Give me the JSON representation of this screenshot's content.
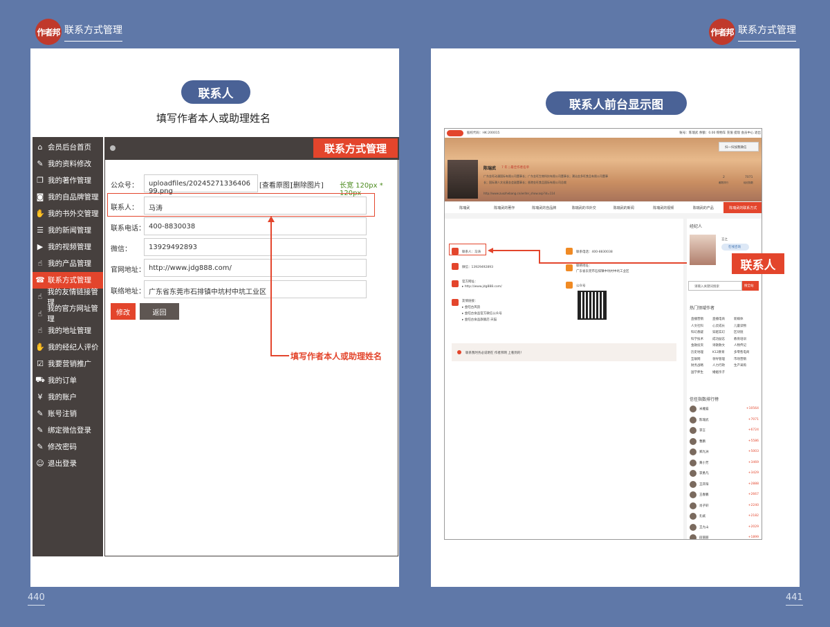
{
  "header": {
    "logo_text": "作者邦",
    "title": "联系方式管理"
  },
  "pages": {
    "left_no": "440",
    "right_no": "441"
  },
  "left": {
    "pill": "联系人",
    "subtitle": "填写作者本人或助理姓名",
    "sidebar": [
      {
        "label": "会员后台首页",
        "icon": "home-icon"
      },
      {
        "label": "我的资料修改",
        "icon": "edit-icon"
      },
      {
        "label": "我的著作管理",
        "icon": "book-icon"
      },
      {
        "label": "我的自品牌管理",
        "icon": "camera-icon"
      },
      {
        "label": "我的书外交管理",
        "icon": "handshake-icon"
      },
      {
        "label": "我的新闻管理",
        "icon": "news-icon"
      },
      {
        "label": "我的视频管理",
        "icon": "play-icon"
      },
      {
        "label": "我的产品管理",
        "icon": "hand-icon"
      },
      {
        "label": "联系方式管理",
        "icon": "phone-icon"
      },
      {
        "label": "我的友情链接管理",
        "icon": "hand-icon"
      },
      {
        "label": "我的官方网址管理",
        "icon": "hand-icon"
      },
      {
        "label": "我的地址管理",
        "icon": "hand-icon"
      },
      {
        "label": "我的经纪人评价",
        "icon": "handshake-icon"
      },
      {
        "label": "我要营销推广",
        "icon": "checkbox-icon"
      },
      {
        "label": "我的订单",
        "icon": "cart-icon"
      },
      {
        "label": "我的账户",
        "icon": "yen-icon"
      },
      {
        "label": "账号注销",
        "icon": "doc-icon"
      },
      {
        "label": "绑定微信登录",
        "icon": "doc-icon"
      },
      {
        "label": "修改密码",
        "icon": "doc-icon"
      },
      {
        "label": "退出登录",
        "icon": "user-icon"
      }
    ],
    "active_index": 8,
    "panel_title": "联系方式管理",
    "form": {
      "gzh_label": "公众号：",
      "gzh_value": "uploadfiles/20245271336406​99.png",
      "view_orig": "[查看原图]",
      "delete_img": "[删除图片]",
      "size_hint": "长宽 120px * 120px",
      "contact_label": "联系人：",
      "contact_value": "马涛",
      "phone_label": "联系电话：",
      "phone_value": "400-8830038",
      "wechat_label": "微信：",
      "wechat_value": "13929492893",
      "site_label": "官网地址：",
      "site_value": "http://www.jdg888.com/",
      "addr_label": "联络地址：",
      "addr_value": "广东省东莞市石排镇中坑村中坑工业区",
      "modify_btn": "修改",
      "back_btn": "返回"
    },
    "annotation": "填写作者本人或助理姓名"
  },
  "right": {
    "pill": "联系人前台显示图",
    "callout": "联系人",
    "site": {
      "topnav_left": "股权代码：HK:200015",
      "topnav_right": "账号：陈瑞武  余额：0.00  购物车  充值  提现  会员中心  退出",
      "scan_btn": "扫一扫加我微信",
      "name": "陈瑞武",
      "tags": "7 年 | 最佳作者名单",
      "desc1": "广东金旺动漫国际有限公司董事长；广东金旺生物科技有限公司董事长；潮汕金多旺食品有限公司董事",
      "desc2": "长；国际潮人文化基金会副董事长；香港金旺食品国际有限公司总裁",
      "url": "http://www.zuozhebang.cn/writer_show.asp?id=114",
      "stat1_num": "2",
      "stat1_label": "著数排行",
      "stat2_num": "7071",
      "stat2_label": "经纪指数",
      "nav": [
        "陈瑞武",
        "陈瑞武的著作",
        "陈瑞武的自品牌",
        "陈瑞武的书外交",
        "陈瑞武的新闻",
        "陈瑞武的视频",
        "陈瑞武的产品",
        "陈瑞武的联系方式"
      ],
      "contact_person": "联系人：马涛",
      "contact_phone": "联系电话：400-8830038",
      "wechat": "微信：13929492893",
      "addr_title": "联络地址：",
      "addr": "广东省东莞市石排镇中坑村中坑工业区",
      "official_title": "官方网址：",
      "official": "▸ http://www.jdg888.com/",
      "gzh": "公众号",
      "friend_title": "友情链接：",
      "friend1": "▸ 金旺古风韵",
      "friend2": "▸ 金旺古食品官方微信公众号",
      "friend3": "▸ 金旺古食品旗舰店·天猫",
      "notice": "联系我时务必说明在 作者邦网 上看到的！",
      "agent_title": "经纪人",
      "agent_name": "言之",
      "agent_btn": "在线咨询",
      "search_ph": "请输入关键词搜索",
      "search_btn": "搜全站",
      "hot_title": "热门领域作者",
      "hot_tags": [
        "直播营销",
        "直播电商",
        "新媒体",
        "人文社科",
        "心灵成长",
        "儿童读物",
        "科幻悬疑",
        "穿越玄幻",
        "区块链",
        "科学技术",
        "成功励志",
        "教育培训",
        "金融投资",
        "诗歌散文",
        "人物传记",
        "历史地理",
        "K12教育",
        "多零售电商",
        "互联网",
        "领导管理",
        "市场营销",
        "财务战略",
        "人力行政",
        "生产采购",
        "国学养生",
        "婚姻亲子"
      ],
      "rank_title": "信任指数排行榜",
      "ranks": [
        {
          "name": "米雅猫",
          "score": "+10564"
        },
        {
          "name": "陈瑞武",
          "score": "+7071"
        },
        {
          "name": "李言",
          "score": "+6724"
        },
        {
          "name": "曹鹏",
          "score": "+5586"
        },
        {
          "name": "郑九洲",
          "score": "+5003"
        },
        {
          "name": "黄小芳",
          "score": "+3469"
        },
        {
          "name": "李勇凡",
          "score": "+3429"
        },
        {
          "name": "王开阳",
          "score": "+2888"
        },
        {
          "name": "王春鹏",
          "score": "+2667"
        },
        {
          "name": "肖子轩",
          "score": "+2240"
        },
        {
          "name": "孔斌",
          "score": "+2182"
        },
        {
          "name": "王九山",
          "score": "+2029"
        },
        {
          "name": "段丽丽",
          "score": "+1899"
        }
      ]
    }
  }
}
